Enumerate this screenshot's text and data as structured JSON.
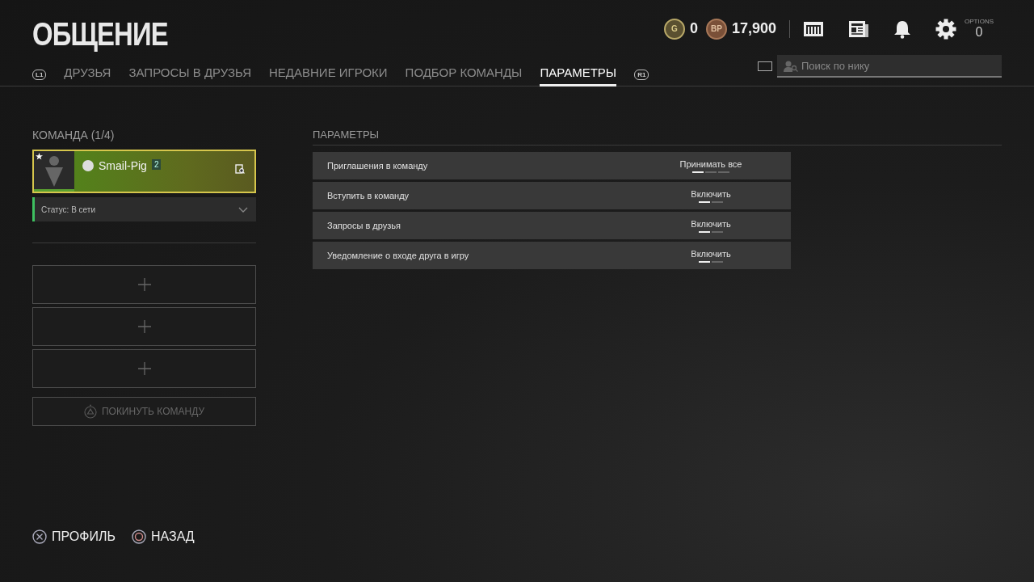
{
  "title": "ОБЩЕНИЕ",
  "tabs": [
    {
      "label": "ДРУЗЬЯ",
      "selected": false
    },
    {
      "label": "ЗАПРОСЫ В ДРУЗЬЯ",
      "selected": false
    },
    {
      "label": "НЕДАВНИЕ ИГРОКИ",
      "selected": false
    },
    {
      "label": "ПОДБОР КОМАНДЫ",
      "selected": false
    },
    {
      "label": "ПАРАМЕТРЫ",
      "selected": true
    }
  ],
  "tab_hints": {
    "prev": "L1",
    "next": "R1"
  },
  "currencies": [
    {
      "kind": "g",
      "symbol": "G",
      "amount": "0"
    },
    {
      "kind": "bp",
      "symbol": "BP",
      "amount": "17,900"
    }
  ],
  "options": {
    "label": "OPTIONS",
    "count": "0"
  },
  "search": {
    "placeholder": "Поиск по нику"
  },
  "team": {
    "heading": "КОМАНДА (1/4)",
    "member": {
      "name": "Smail-Pig",
      "level": "2",
      "leader": true
    },
    "status": "Статус: В сети",
    "empty_slots": [
      {
        "kind": "empty"
      },
      {
        "kind": "empty"
      },
      {
        "kind": "empty"
      }
    ],
    "leave_button": "ПОКИНУТЬ КОМАНДУ"
  },
  "settings": {
    "heading": "ПАРАМЕТРЫ",
    "rows": [
      {
        "label": "Приглашения в команду",
        "value": "Принимать все",
        "options": [
          {
            "selected": true
          },
          {
            "selected": false
          },
          {
            "selected": false
          }
        ]
      },
      {
        "label": "Вступить в команду",
        "value": "Включить",
        "options": [
          {
            "selected": true
          },
          {
            "selected": false
          }
        ]
      },
      {
        "label": "Запросы в друзья",
        "value": "Включить",
        "options": [
          {
            "selected": true
          },
          {
            "selected": false
          }
        ]
      },
      {
        "label": "Уведомление о входе друга в игру",
        "value": "Включить",
        "options": [
          {
            "selected": true
          },
          {
            "selected": false
          }
        ]
      }
    ]
  },
  "footer": [
    {
      "kind": "cross",
      "label": "ПРОФИЛЬ"
    },
    {
      "kind": "circle",
      "label": "НАЗАД"
    }
  ]
}
